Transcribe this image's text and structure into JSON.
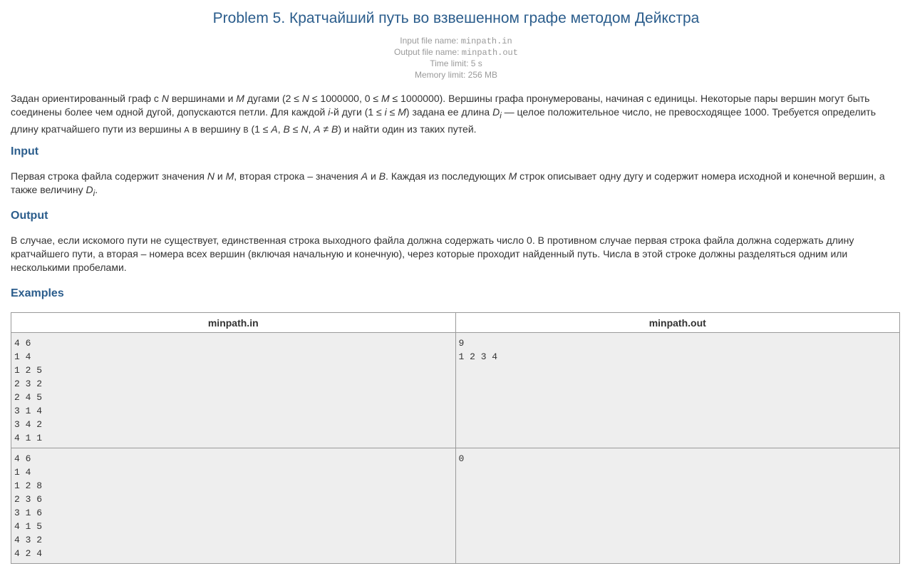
{
  "problem": {
    "title": "Problem 5. Кратчайший путь во взвешенном графе методом Дейкстра",
    "meta": {
      "input_label": "Input file name:",
      "input_file": "minpath.in",
      "output_label": "Output file name:",
      "output_file": "minpath.out",
      "time_label": "Time limit:",
      "time_value": "5 s",
      "memory_label": "Memory limit:",
      "memory_value": "256 MB"
    },
    "statement": {
      "p1": "Задан ориентированный граф с ",
      "N": "N",
      "p2": " вершинами и ",
      "M": "M",
      "p3": " дугами (2 ≤ ",
      "p4": " ≤ 1000000, 0 ≤ ",
      "p5": " ≤ 1000000). Вершины графа пронумерованы, начиная с единицы. Некоторые пары вершин могут быть",
      "line2a": "соединены более чем одной дугой, допускаются петли. Для каждой ",
      "i": "i",
      "line2b": "-й дуги (1 ≤ ",
      "line2c": " ≤ ",
      "line2d": ") задана ее длина ",
      "D": "D",
      "line2e": " — целое положительное число, не превосходящее 1000. Требуется определить",
      "line3a": "длину кратчайшего пути из вершины ",
      "A_mono": "A",
      "line3b": " в вершину ",
      "B_mono": "B",
      "line3c": " (1 ≤ ",
      "A": "A",
      "comma": ", ",
      "B": "B",
      "line3d": " ≤ ",
      "neq": " ≠ ",
      "line3e": ") и найти один из таких путей."
    },
    "input_section": {
      "heading": "Input",
      "t1": "Первая строка файла содержит значения ",
      "N": "N",
      "t2": " и ",
      "M": "M",
      "t3": ", вторая строка – значения ",
      "A": "A",
      "t4": " и ",
      "B": "B",
      "t5": ". Каждая из последующих ",
      "t6": " строк описывает одну дугу и содержит номера исходной и конечной вершин, а",
      "t7": "также величину ",
      "D": "D",
      "i": "i",
      "t8": "."
    },
    "output_section": {
      "heading": "Output",
      "line1": "В случае, если искомого пути не существует, единственная строка выходного файла должна содержать число 0. В противном случае первая строка файла должна содержать длину",
      "line2": "кратчайшего пути, а вторая – номера всех вершин (включая начальную и конечную), через которые проходит найденный путь. Числа в этой строке должны разделяться одним или",
      "line3": "несколькими пробелами."
    },
    "examples": {
      "heading": "Examples",
      "col_in": "minpath.in",
      "col_out": "minpath.out",
      "rows": [
        {
          "in": [
            "4 6",
            "1 4",
            "1 2 5",
            "2 3 2",
            "2 4 5",
            "3 1 4",
            "3 4 2",
            "4 1 1"
          ],
          "out": [
            "9",
            "1 2 3 4"
          ]
        },
        {
          "in": [
            "4 6",
            "1 4",
            "1 2 8",
            "2 3 6",
            "3 1 6",
            "4 1 5",
            "4 3 2",
            "4 2 4"
          ],
          "out": [
            "0"
          ]
        }
      ]
    }
  }
}
